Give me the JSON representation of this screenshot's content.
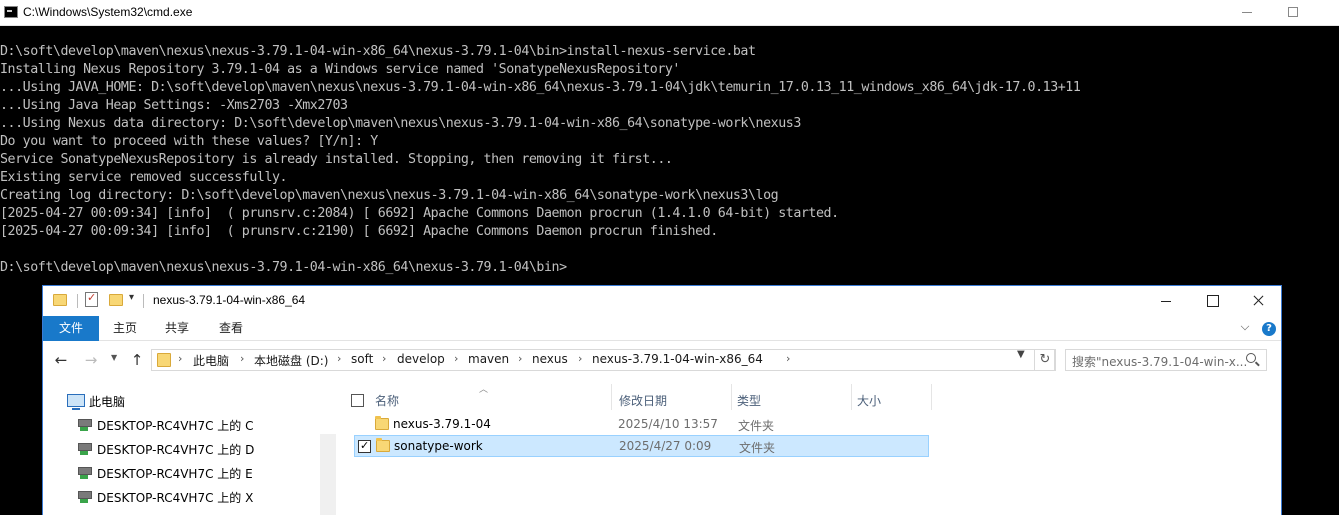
{
  "cmd": {
    "title": "C:\\Windows\\System32\\cmd.exe",
    "lines": [
      "D:\\soft\\develop\\maven\\nexus\\nexus-3.79.1-04-win-x86_64\\nexus-3.79.1-04\\bin>install-nexus-service.bat",
      "Installing Nexus Repository 3.79.1-04 as a Windows service named 'SonatypeNexusRepository'",
      "...Using JAVA_HOME: D:\\soft\\develop\\maven\\nexus\\nexus-3.79.1-04-win-x86_64\\nexus-3.79.1-04\\jdk\\temurin_17.0.13_11_windows_x86_64\\jdk-17.0.13+11",
      "...Using Java Heap Settings: -Xms2703 -Xmx2703",
      "...Using Nexus data directory: D:\\soft\\develop\\maven\\nexus\\nexus-3.79.1-04-win-x86_64\\sonatype-work\\nexus3",
      "Do you want to proceed with these values? [Y/n]: Y",
      "Service SonatypeNexusRepository is already installed. Stopping, then removing it first...",
      "Existing service removed successfully.",
      "Creating log directory: D:\\soft\\develop\\maven\\nexus\\nexus-3.79.1-04-win-x86_64\\sonatype-work\\nexus3\\log",
      "[2025-04-27 00:09:34] [info]  ( prunsrv.c:2084) [ 6692] Apache Commons Daemon procrun (1.4.1.0 64-bit) started.",
      "[2025-04-27 00:09:34] [info]  ( prunsrv.c:2190) [ 6692] Apache Commons Daemon procrun finished.",
      "",
      "D:\\soft\\develop\\maven\\nexus\\nexus-3.79.1-04-win-x86_64\\nexus-3.79.1-04\\bin>"
    ]
  },
  "explorer": {
    "title": "nexus-3.79.1-04-win-x86_64",
    "ribbon_tabs": [
      "文件",
      "主页",
      "共享",
      "查看"
    ],
    "help_label": "?",
    "breadcrumbs": [
      "此电脑",
      "本地磁盘 (D:)",
      "soft",
      "develop",
      "maven",
      "nexus",
      "nexus-3.79.1-04-win-x86_64"
    ],
    "search_placeholder": "搜索\"nexus-3.79.1-04-win-x...",
    "nav_items": [
      {
        "label": "此电脑",
        "icon": "computer-icon"
      },
      {
        "label": "DESKTOP-RC4VH7C 上的 C",
        "icon": "network-drive-icon"
      },
      {
        "label": "DESKTOP-RC4VH7C 上的 D",
        "icon": "network-drive-icon"
      },
      {
        "label": "DESKTOP-RC4VH7C 上的 E",
        "icon": "network-drive-icon"
      },
      {
        "label": "DESKTOP-RC4VH7C 上的 X",
        "icon": "network-drive-icon"
      }
    ],
    "columns": [
      "名称",
      "修改日期",
      "类型",
      "大小"
    ],
    "files": [
      {
        "name": "nexus-3.79.1-04",
        "date": "2025/4/10 13:57",
        "type": "文件夹",
        "selected": false
      },
      {
        "name": "sonatype-work",
        "date": "2025/4/27 0:09",
        "type": "文件夹",
        "selected": true
      }
    ]
  }
}
